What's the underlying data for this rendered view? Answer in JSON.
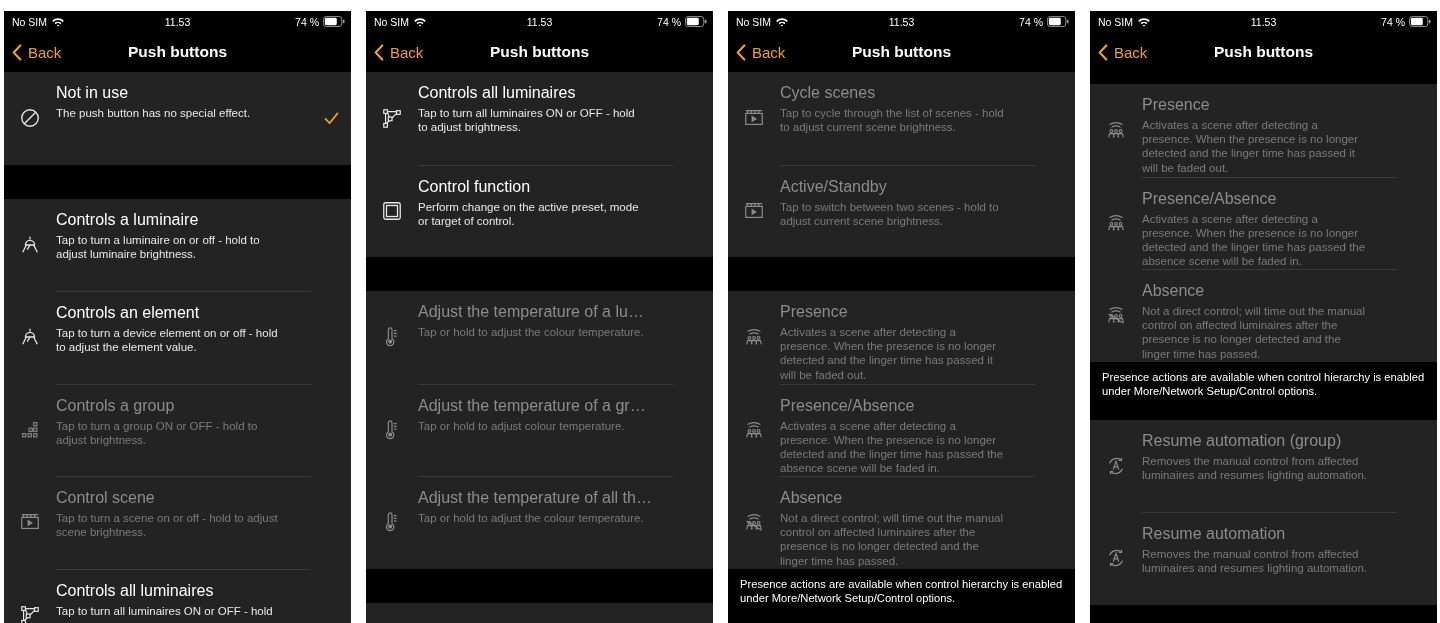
{
  "screens": [
    {
      "status_bar": {
        "carrier": "No SIM",
        "time": "11.53",
        "battery": "74 %"
      },
      "nav": {
        "back": "Back",
        "title": "Push buttons"
      },
      "blocks": [
        {
          "kind": "group",
          "items": [
            {
              "kind": "prohibited",
              "title": "Not in use",
              "description": "The push button has no special effect.",
              "disabled": false,
              "selected": true
            }
          ]
        },
        {
          "kind": "gap"
        },
        {
          "kind": "group",
          "items": [
            {
              "kind": "luminaire",
              "title": "Controls a luminaire",
              "description": "Tap to turn a luminaire on or off - hold to adjust luminaire brightness.",
              "disabled": false,
              "selected": false
            },
            {
              "kind": "luminaire",
              "title": "Controls an element",
              "description": "Tap to turn a device element on or off - hold to adjust the element value.",
              "disabled": false,
              "selected": false
            },
            {
              "kind": "group",
              "title": "Controls a group",
              "description": "Tap to turn a group ON or OFF - hold to adjust brightness.",
              "disabled": true,
              "selected": false
            },
            {
              "kind": "scene",
              "title": "Control scene",
              "description": "Tap to turn a scene on or off - hold to adjust scene brightness.",
              "disabled": true,
              "selected": false
            },
            {
              "kind": "network",
              "title": "Controls all luminaires",
              "description": "Tap to turn all luminaires ON or OFF - hold",
              "disabled": false,
              "selected": false
            }
          ]
        }
      ]
    },
    {
      "status_bar": {
        "carrier": "No SIM",
        "time": "11.53",
        "battery": "74 %"
      },
      "nav": {
        "back": "Back",
        "title": "Push buttons"
      },
      "blocks": [
        {
          "kind": "group",
          "items": [
            {
              "kind": "network",
              "title": "Controls all luminaires",
              "description": "Tap to turn all luminaires ON or OFF - hold to adjust brightness.",
              "disabled": false,
              "selected": false
            },
            {
              "kind": "square",
              "title": "Control function",
              "description": "Perform change on the active preset, mode or target of control.",
              "disabled": false,
              "selected": false
            }
          ]
        },
        {
          "kind": "gap"
        },
        {
          "kind": "group",
          "items": [
            {
              "kind": "thermometer",
              "title": "Adjust the temperature of a lu…",
              "description": "Tap or hold to adjust the colour temperature.",
              "disabled": true,
              "selected": false
            },
            {
              "kind": "thermometer",
              "title": "Adjust the temperature of a gr…",
              "description": "Tap or hold to adjust colour temperature.",
              "disabled": true,
              "selected": false
            },
            {
              "kind": "thermometer",
              "title": "Adjust the temperature of all th…",
              "description": "Tap or hold to adjust the colour temperature.",
              "disabled": true,
              "selected": false
            }
          ]
        },
        {
          "kind": "gap"
        },
        {
          "kind": "panel_edge"
        }
      ]
    },
    {
      "status_bar": {
        "carrier": "No SIM",
        "time": "11.53",
        "battery": "74 %"
      },
      "nav": {
        "back": "Back",
        "title": "Push buttons"
      },
      "blocks": [
        {
          "kind": "group",
          "items": [
            {
              "kind": "scene",
              "title": "Cycle scenes",
              "description": "Tap to cycle through the list of scenes - hold to adjust current scene brightness.",
              "disabled": true,
              "selected": false
            },
            {
              "kind": "scene",
              "title": "Active/Standby",
              "description": "Tap to switch between two scenes - hold to adjust current scene brightness.",
              "disabled": true,
              "selected": false
            }
          ]
        },
        {
          "kind": "gap"
        },
        {
          "kind": "group",
          "items": [
            {
              "kind": "presence",
              "title": "Presence",
              "description": "Activates a scene after detecting a presence. When the presence is no longer detected and the linger time has passed it will be faded out.",
              "disabled": true,
              "selected": false
            },
            {
              "kind": "presence",
              "title": "Presence/Absence",
              "description": "Activates a scene after detecting a presence. When the presence is no longer detected and the linger time has passed the absence scene will be faded in.",
              "disabled": true,
              "selected": false
            },
            {
              "kind": "absence",
              "title": "Absence",
              "description": "Not a direct control; will time out the manual control on affected luminaires after the presence is no longer detected and the linger time has passed.",
              "disabled": true,
              "selected": false
            }
          ]
        },
        {
          "kind": "note",
          "text": "Presence actions are available when control hierarchy is enabled under More/Network Setup/Control options."
        }
      ]
    },
    {
      "status_bar": {
        "carrier": "No SIM",
        "time": "11.53",
        "battery": "74 %"
      },
      "nav": {
        "back": "Back",
        "title": "Push buttons"
      },
      "blocks": [
        {
          "kind": "gap_edge"
        },
        {
          "kind": "group",
          "items": [
            {
              "kind": "presence",
              "title": "Presence",
              "description": "Activates a scene after detecting a presence. When the presence is no longer detected and the linger time has passed it will be faded out.",
              "disabled": true,
              "selected": false
            },
            {
              "kind": "presence",
              "title": "Presence/Absence",
              "description": "Activates a scene after detecting a presence. When the presence is no longer detected and the linger time has passed the absence scene will be faded in.",
              "disabled": true,
              "selected": false
            },
            {
              "kind": "absence",
              "title": "Absence",
              "description": "Not a direct control; will time out the manual control on affected luminaires after the presence is no longer detected and the linger time has passed.",
              "disabled": true,
              "selected": false
            }
          ]
        },
        {
          "kind": "note",
          "text": "Presence actions are available when control hierarchy is enabled under More/Network Setup/Control options."
        },
        {
          "kind": "group",
          "items": [
            {
              "kind": "resume",
              "title": "Resume automation (group)",
              "description": "Removes the manual control from affected luminaires and resumes lighting automation.",
              "disabled": true,
              "selected": false
            },
            {
              "kind": "resume",
              "title": "Resume automation",
              "description": "Removes the manual control from affected luminaires and resumes lighting automation.",
              "disabled": true,
              "selected": false
            }
          ]
        },
        {
          "kind": "gap"
        }
      ]
    }
  ]
}
